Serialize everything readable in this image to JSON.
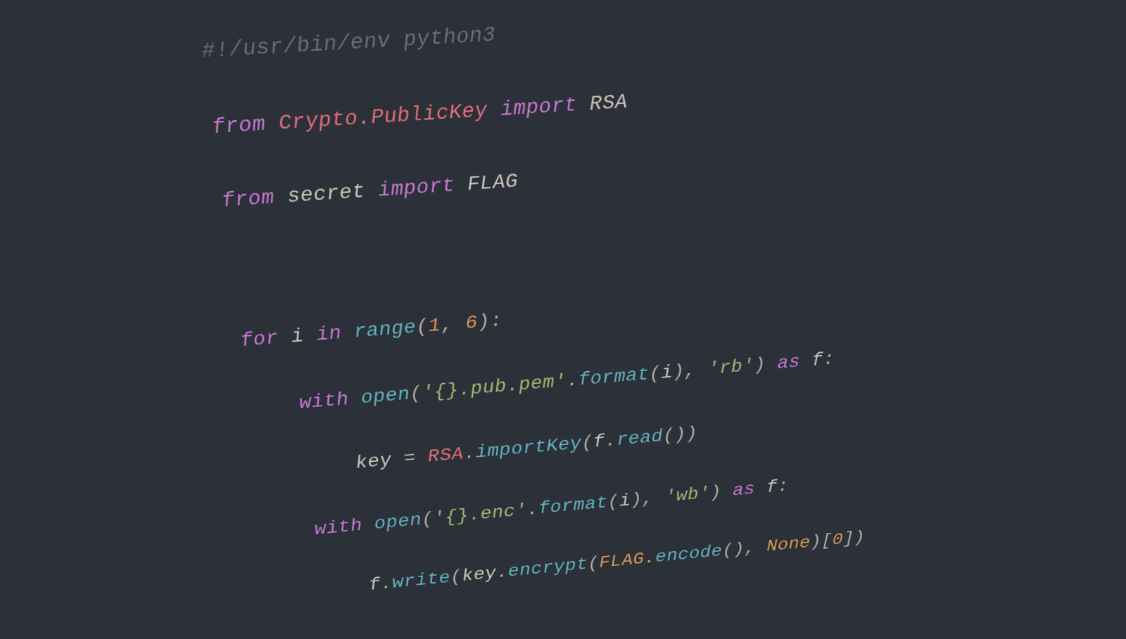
{
  "code": {
    "line1": {
      "shebang": "#!/usr/bin/env python3"
    },
    "line2": {
      "from": "from",
      "mod": "Crypto.PublicKey",
      "import": "import",
      "name": "RSA"
    },
    "line3": {
      "from": "from",
      "mod": "secret",
      "import": "import",
      "name": "FLAG"
    },
    "line5": {
      "for": "for",
      "i": "i",
      "in": "in",
      "range": "range",
      "open_paren": "(",
      "n1": "1",
      "comma": ", ",
      "n2": "6",
      "close": "):"
    },
    "line6": {
      "with": "with",
      "open": "open",
      "p1": "(",
      "str1": "'{}.pub.pem'",
      "dot1": ".",
      "format": "format",
      "p2": "(",
      "i": "i",
      "close1": "), ",
      "str2": "'rb'",
      "close2": ") ",
      "as": "as",
      "f": " f",
      "colon": ":"
    },
    "line7": {
      "key": "key",
      "eq": " = ",
      "rsa": "RSA",
      "dot1": ".",
      "ik": "importKey",
      "p1": "(",
      "f": "f",
      "dot2": ".",
      "read": "read",
      "close": "())"
    },
    "line8": {
      "with": "with",
      "open": "open",
      "p1": "(",
      "str1": "'{}.enc'",
      "dot1": ".",
      "format": "format",
      "p2": "(",
      "i": "i",
      "close1": "), ",
      "str2": "'wb'",
      "close2": ") ",
      "as": "as",
      "f": " f",
      "colon": ":"
    },
    "line9": {
      "f": "f",
      "dot1": ".",
      "write": "write",
      "p1": "(",
      "key": "key",
      "dot2": ".",
      "encrypt": "encrypt",
      "p2": "(",
      "flag": "FLAG",
      "dot3": ".",
      "encode": "encode",
      "p3": "(), ",
      "none": "None",
      "close1": ")[",
      "zero": "0",
      "close2": "])"
    }
  }
}
